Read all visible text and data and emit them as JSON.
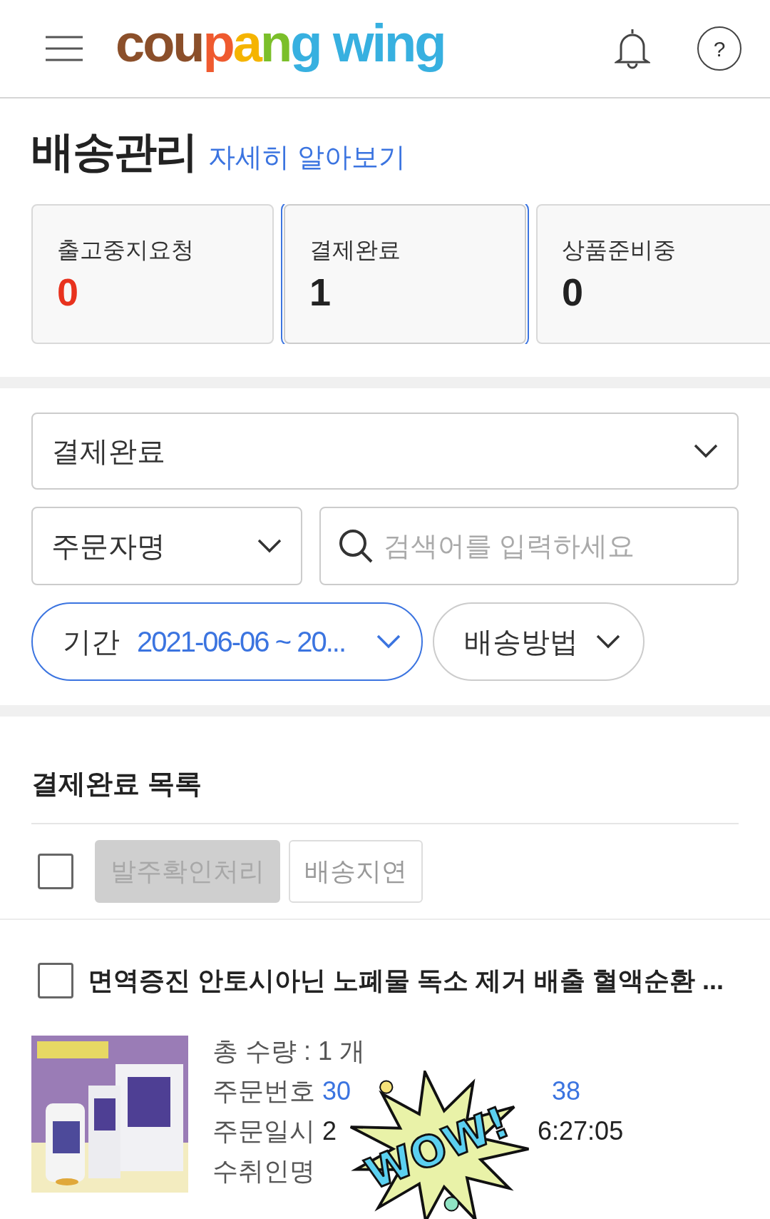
{
  "header": {
    "logo": {
      "brand": "coupang",
      "product": "wing"
    },
    "help": "?"
  },
  "page": {
    "title": "배송관리",
    "help_link": "자세히 알아보기"
  },
  "status_cards": [
    {
      "label": "출고중지요청",
      "count": "0",
      "alert": true,
      "selected": false
    },
    {
      "label": "결제완료",
      "count": "1",
      "alert": false,
      "selected": true
    },
    {
      "label": "상품준비중",
      "count": "0",
      "alert": false,
      "selected": false
    }
  ],
  "filters": {
    "status_select": "결제완료",
    "search_type_select": "주문자명",
    "search": {
      "placeholder": "검색어를 입력하세요"
    },
    "period": {
      "label": "기간",
      "value": "2021-06-06 ~ 20..."
    },
    "shipping_method": "배송방법"
  },
  "list": {
    "title": "결제완료 목록",
    "select_all_checked": false,
    "actions": [
      {
        "label": "발주확인처리",
        "disabled": true
      },
      {
        "label": "배송지연",
        "disabled": false
      }
    ],
    "orders": [
      {
        "checked": false,
        "product_name": "면역증진 안토시아닌 노폐물 독소 제거 배출 혈액순환 ...",
        "details": [
          {
            "label": "총 수량 : 1 개"
          },
          {
            "label": "주문번호",
            "value_start": "30",
            "value_end": "38",
            "link": true
          },
          {
            "label": "주문일시",
            "value_start": "2",
            "value_end": "6:27:05",
            "link": false
          },
          {
            "label": "수취인명"
          }
        ]
      }
    ]
  },
  "sticker": {
    "text": "WOW!"
  }
}
